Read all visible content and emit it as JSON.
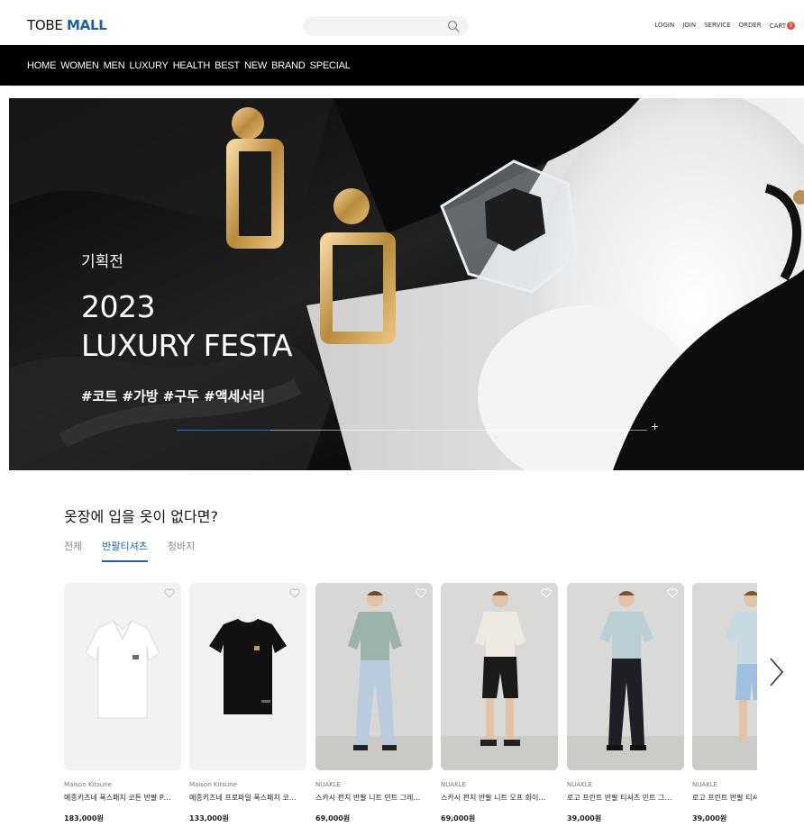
{
  "header": {
    "logo_part1": "TOBE ",
    "logo_part2": "MALL",
    "search_placeholder": "",
    "util": {
      "login": "LOGIN",
      "join": "JOIN",
      "service": "SERVICE",
      "order": "ORDER",
      "cart": "CART",
      "cart_count": "0"
    }
  },
  "nav": [
    "HOME",
    "WOMEN",
    "MEN",
    "LUXURY",
    "HEALTH",
    "BEST",
    "NEW",
    "BRAND",
    "SPECIAL"
  ],
  "hero": {
    "tag": "기획전",
    "year": "2023",
    "title": "LUXURY FESTA",
    "hashtags": "#코트 #가방 #구두 #액세서리",
    "progress": 0.2,
    "plus": "+"
  },
  "section": {
    "title": "옷장에 입을 옷이 없다면?",
    "tabs": [
      {
        "label": "전체",
        "active": false
      },
      {
        "label": "반팔티셔츠",
        "active": true
      },
      {
        "label": "청바지",
        "active": false
      }
    ]
  },
  "products": [
    {
      "brand": "Maison Kitsune",
      "name": "메종키츠네 폭스패치 코튼 반팔 P…",
      "price": "183,000원",
      "image": "white-polo"
    },
    {
      "brand": "Maison Kitsune",
      "name": "메종키츠네 프로파일 폭스패치 코…",
      "price": "133,000원",
      "image": "black-tee"
    },
    {
      "brand": "NUAKLE",
      "name": "스카시 펀치 반팔 니트 민트 그레…",
      "price": "69,000원",
      "image": "model-mint-knit"
    },
    {
      "brand": "NUAKLE",
      "name": "스카시 펀치 반팔 니트 오프 화이…",
      "price": "69,000원",
      "image": "model-white-knit"
    },
    {
      "brand": "NUAKLE",
      "name": "로고 프린트 반팔 티셔츠 민트 그…",
      "price": "39,000원",
      "image": "model-mint-tee"
    },
    {
      "brand": "NUAKLE",
      "name": "로고 프린트 반팔 티셔츠",
      "price": "39,000원",
      "image": "model-mint-tee-2"
    }
  ],
  "colors": {
    "brand_blue": "#1d5fb4",
    "nav_bg": "#000000",
    "badge_red": "#e8473b"
  }
}
